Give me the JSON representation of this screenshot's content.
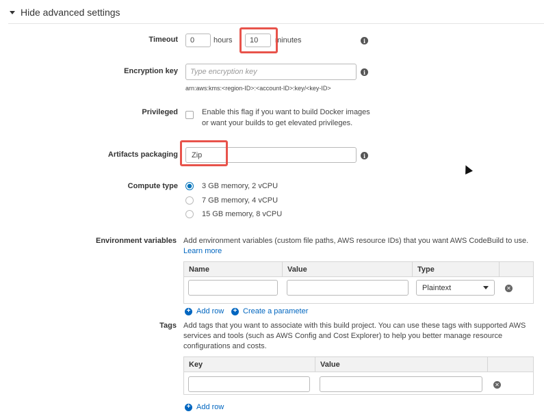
{
  "section": {
    "title": "Hide advanced settings"
  },
  "timeout": {
    "label": "Timeout",
    "hours_value": "0",
    "hours_unit": "hours",
    "minutes_value": "10",
    "minutes_unit": "minutes"
  },
  "encryption": {
    "label": "Encryption key",
    "placeholder": "Type encryption key",
    "hint": "arn:aws:kms:<region-ID>:<account-ID>:key/<key-ID>"
  },
  "privileged": {
    "label": "Privileged",
    "line1": "Enable this flag if you want to build Docker images",
    "line2": "or want your builds to get elevated privileges.",
    "checked": false
  },
  "artifacts": {
    "label": "Artifacts packaging",
    "value": "Zip"
  },
  "compute": {
    "label": "Compute type",
    "options": [
      {
        "label": "3 GB memory, 2 vCPU",
        "selected": true
      },
      {
        "label": "7 GB memory, 4 vCPU",
        "selected": false
      },
      {
        "label": "15 GB memory, 8 vCPU",
        "selected": false
      }
    ]
  },
  "env": {
    "label": "Environment variables",
    "description": "Add environment variables (custom file paths, AWS resource IDs) that you want AWS CodeBuild to use.",
    "learn_more": "Learn more",
    "columns": [
      "Name",
      "Value",
      "Type"
    ],
    "type_value": "Plaintext",
    "add_row": "Add row",
    "create_param": "Create a parameter"
  },
  "tags": {
    "label": "Tags",
    "line1": "Add tags that you want to associate with this build project. You can use these tags with supported AWS",
    "line2": "services and tools (such as AWS Config and Cost Explorer) to help you better manage resource",
    "line3": "configurations and costs.",
    "columns": [
      "Key",
      "Value"
    ],
    "add_row": "Add row"
  },
  "colors": {
    "accent": "#0066c0",
    "highlight": "#e8534b",
    "radio": "#0073bb"
  }
}
